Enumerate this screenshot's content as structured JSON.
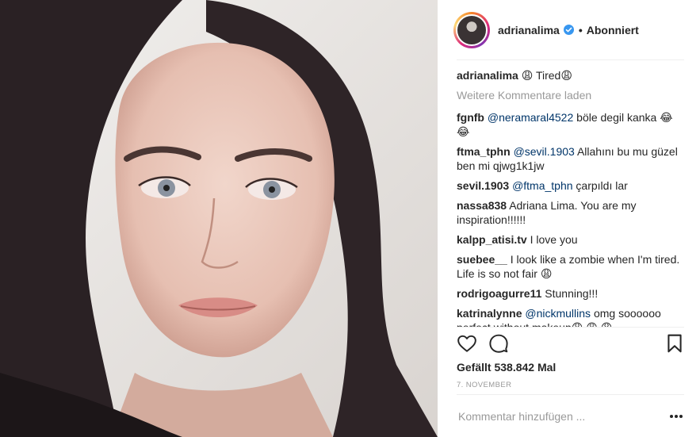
{
  "post": {
    "author": "adrianalima",
    "follow_state": "Abonniert",
    "dot": "•",
    "caption": {
      "user": "adrianalima",
      "text": "😩 Tired😩"
    },
    "load_more": "Weitere Kommentare laden",
    "comments": [
      {
        "user": "fgnfb",
        "mention": "@neramaral4522",
        "text": " böle degil kanka 😂😂"
      },
      {
        "user": "ftma_tphn",
        "mention": "@sevil.1903",
        "text": " Allahını bu mu güzel ben mi qjwg1k1jw"
      },
      {
        "user": "sevil.1903",
        "mention": "@ftma_tphn",
        "text": " çarpıldı lar"
      },
      {
        "user": "nassa838",
        "mention": "",
        "text": "Adriana Lima. You are my inspiration!!!!!!"
      },
      {
        "user": "kalpp_atisi.tv",
        "mention": "",
        "text": "I love you"
      },
      {
        "user": "suebee__",
        "mention": "",
        "text": "I look like a zombie when I'm tired. Life is so not fair 😩"
      },
      {
        "user": "rodrigoagurre11",
        "mention": "",
        "text": "Stunning!!!"
      },
      {
        "user": "katrinalynne",
        "mention": "@nickmullins",
        "text": " omg soooooo perfect without makeup😩 😩 😩"
      }
    ],
    "likes": "Gefällt 538.842 Mal",
    "date": "7. NOVEMBER",
    "comment_placeholder": "Kommentar hinzufügen ...",
    "icons": {
      "like": "heart-icon",
      "comment": "comment-bubble-icon",
      "save": "bookmark-icon",
      "verified": "verified-badge-icon",
      "more": "more-options-icon"
    },
    "colors": {
      "text": "#262626",
      "muted": "#999999",
      "mention": "#003569",
      "verified": "#3897f0",
      "divider": "#efefef"
    }
  }
}
